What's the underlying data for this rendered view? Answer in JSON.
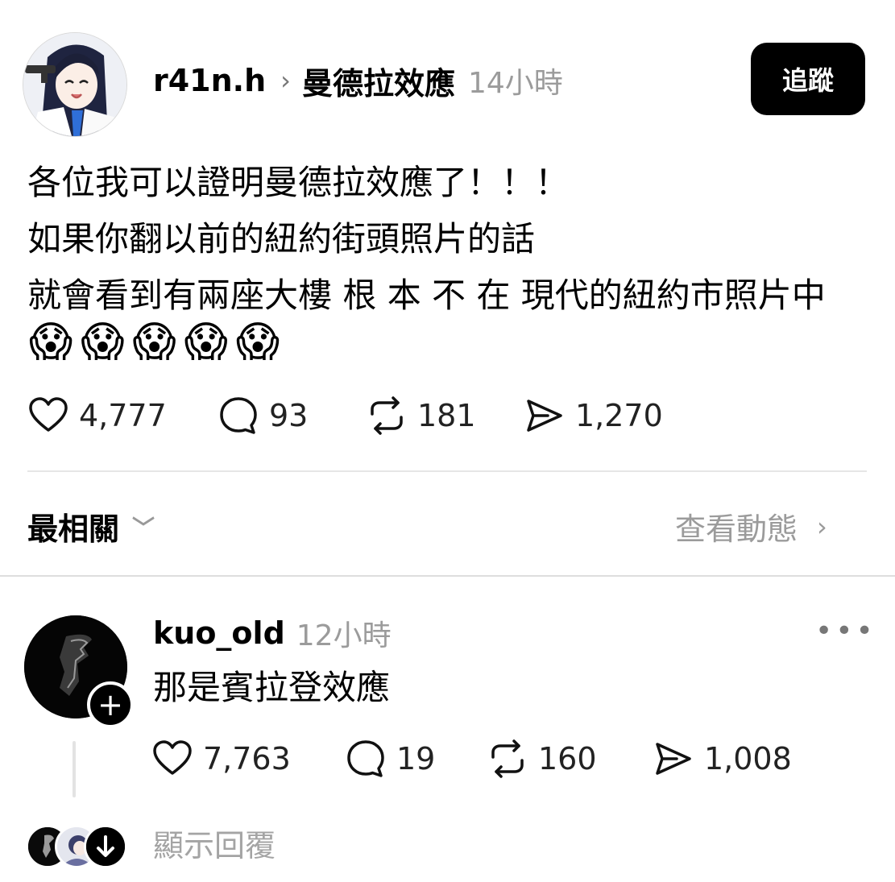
{
  "post": {
    "username": "r41n.h",
    "topic": "曼德拉效應",
    "time": "14小時",
    "follow_label": "追蹤",
    "lines": [
      "各位我可以證明曼德拉效應了！！！",
      "如果你翻以前的紐約街頭照片的話",
      "就會看到有兩座大樓 根 本 不 在 現代的紐約市照片中"
    ],
    "emojis": [
      "😱",
      "😱",
      "😱",
      "😱",
      "😱"
    ],
    "stats": {
      "likes": "4,777",
      "comments": "93",
      "reposts": "181",
      "shares": "1,270"
    }
  },
  "sort": {
    "label": "最相關",
    "activity_label": "查看動態"
  },
  "reply": {
    "username": "kuo_old",
    "time": "12小時",
    "text": "那是賓拉登效應",
    "stats": {
      "likes": "7,763",
      "comments": "19",
      "reposts": "160",
      "shares": "1,008"
    },
    "show_replies_label": "顯示回覆"
  },
  "icons": {
    "chevron_right": "›",
    "chevron_down": "﹀",
    "more": "•••",
    "plus": "+"
  }
}
